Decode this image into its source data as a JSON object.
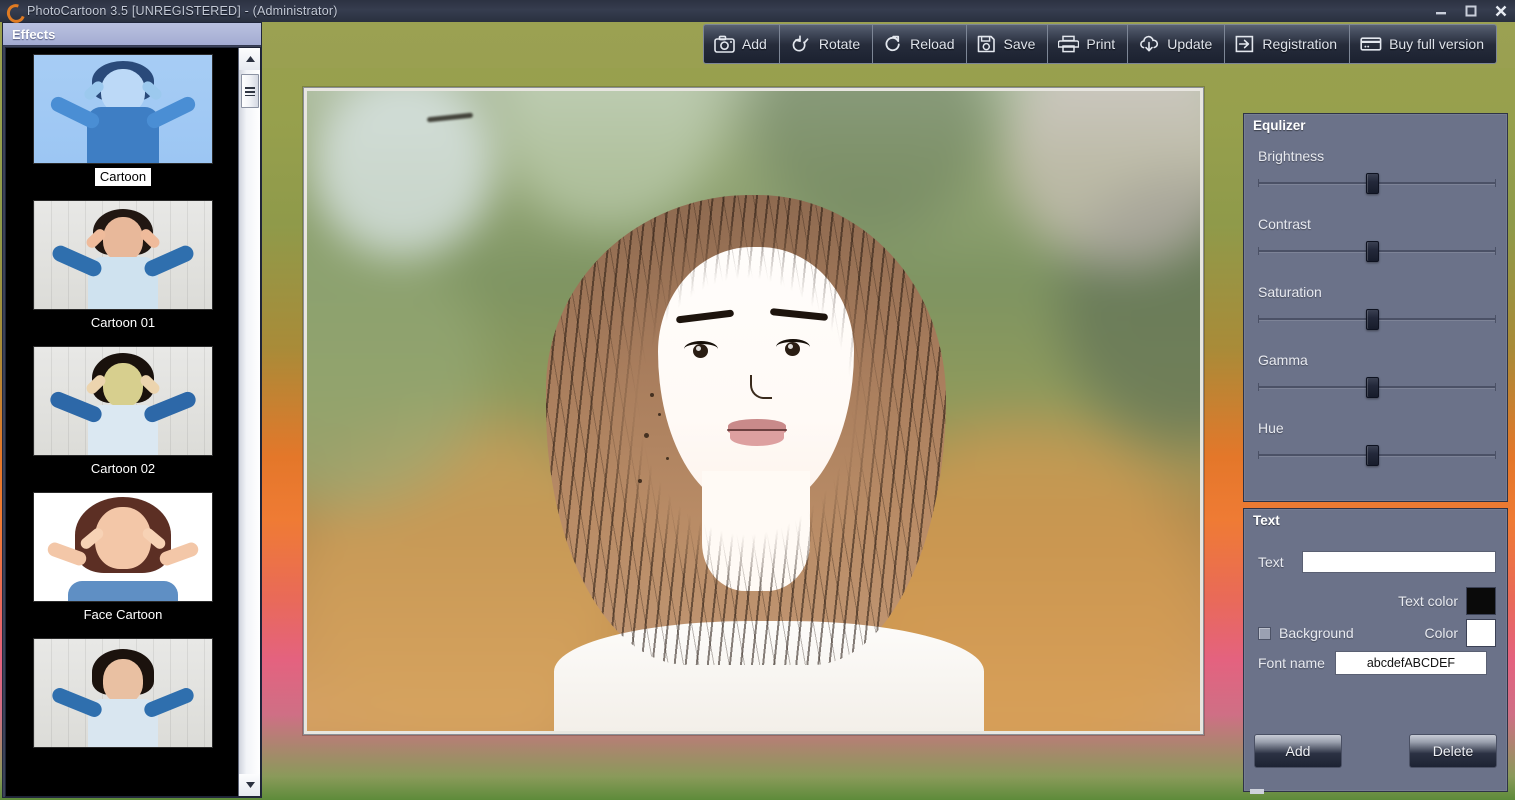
{
  "window": {
    "title": "PhotoCartoon 3.5 [UNREGISTERED] - (Administrator)",
    "icon": "app-logo-icon",
    "controls": [
      {
        "name": "minimize",
        "glyph": "minimize-icon"
      },
      {
        "name": "maximize",
        "glyph": "maximize-icon"
      },
      {
        "name": "close",
        "glyph": "close-icon"
      }
    ]
  },
  "toolbar": {
    "buttons": [
      {
        "label": "Add",
        "icon": "camera-icon"
      },
      {
        "label": "Rotate",
        "icon": "rotate-icon"
      },
      {
        "label": "Reload",
        "icon": "reload-icon"
      },
      {
        "label": "Save",
        "icon": "floppy-disk-icon"
      },
      {
        "label": "Print",
        "icon": "printer-icon"
      },
      {
        "label": "Update",
        "icon": "cloud-download-icon"
      },
      {
        "label": "Registration",
        "icon": "arrow-into-box-icon"
      },
      {
        "label": "Buy full version",
        "icon": "credit-card-icon"
      }
    ]
  },
  "effects": {
    "tab_label": "Effects",
    "selected": "Cartoon",
    "items": [
      {
        "label": "Cartoon",
        "style": "blue",
        "selected": true
      },
      {
        "label": "Cartoon 01",
        "style": "wood",
        "selected": false
      },
      {
        "label": "Cartoon 02",
        "style": "wood",
        "selected": false
      },
      {
        "label": "Face Cartoon",
        "style": "white",
        "selected": false
      },
      {
        "label": "",
        "style": "wood",
        "selected": false
      }
    ],
    "scrollbar": {
      "up_icon": "scroll-up-arrow-icon",
      "down_icon": "scroll-down-arrow-icon",
      "thumb_icon": "scroll-thumb-grip-icon"
    }
  },
  "equalizer": {
    "title": "Equlizer",
    "sliders": [
      {
        "label": "Brightness",
        "value": 48
      },
      {
        "label": "Contrast",
        "value": 48
      },
      {
        "label": "Saturation",
        "value": 48
      },
      {
        "label": "Gamma",
        "value": 48
      },
      {
        "label": "Hue",
        "value": 48
      }
    ]
  },
  "text_panel": {
    "title": "Text",
    "text_label": "Text",
    "text_value": "",
    "text_color_label": "Text color",
    "text_color": "#0a0a0a",
    "background_label": "Background",
    "background_checked": false,
    "color_label": "Color",
    "background_color": "#ffffff",
    "font_name_label": "Font name",
    "font_name_value": "abcdefABCDEF",
    "add_label": "Add",
    "delete_label": "Delete"
  },
  "colors": {
    "panel_bg": "#6b7289",
    "tab_header": "#aeb6d8",
    "desktop_top": "#9aa04e",
    "desktop_mid": "#e4772a",
    "desktop_low": "#e4627f",
    "desktop_bottom": "#5d8b3a",
    "toolbar_button": "#262c3b"
  }
}
